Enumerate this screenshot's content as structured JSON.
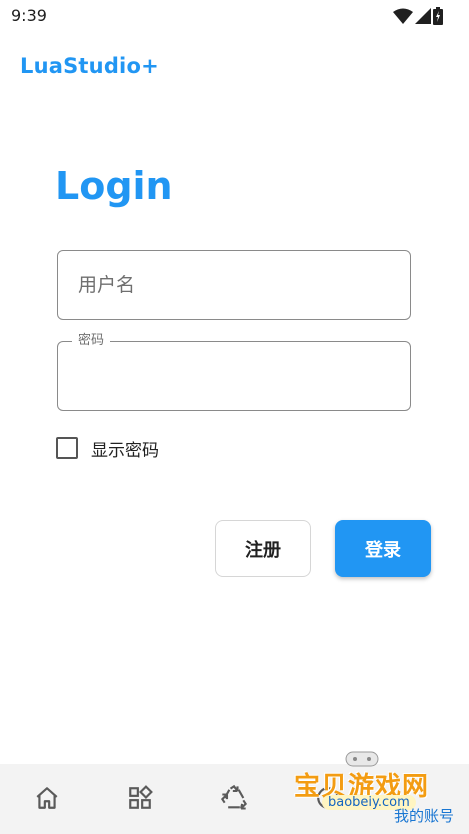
{
  "status_bar": {
    "time": "9:39",
    "icons": [
      "wifi-icon",
      "signal-icon",
      "battery-icon"
    ]
  },
  "app": {
    "title": "LuaStudio+"
  },
  "login": {
    "heading": "Login",
    "username": {
      "placeholder": "用户名",
      "value": ""
    },
    "password": {
      "label": "密码",
      "value": ""
    },
    "show_password": {
      "label": "显示密码",
      "checked": false
    },
    "register_label": "注册",
    "login_label": "登录"
  },
  "bottom_nav": {
    "items": [
      "home-icon",
      "apps-icon",
      "recycle-icon",
      "account-icon"
    ],
    "account_label": "我的账号"
  },
  "watermark": {
    "text": "宝贝游戏网",
    "url": "baobeiy.com"
  },
  "colors": {
    "accent": "#2196f3",
    "nav_background": "#f3f3f3",
    "field_border": "#8a8a8a"
  }
}
